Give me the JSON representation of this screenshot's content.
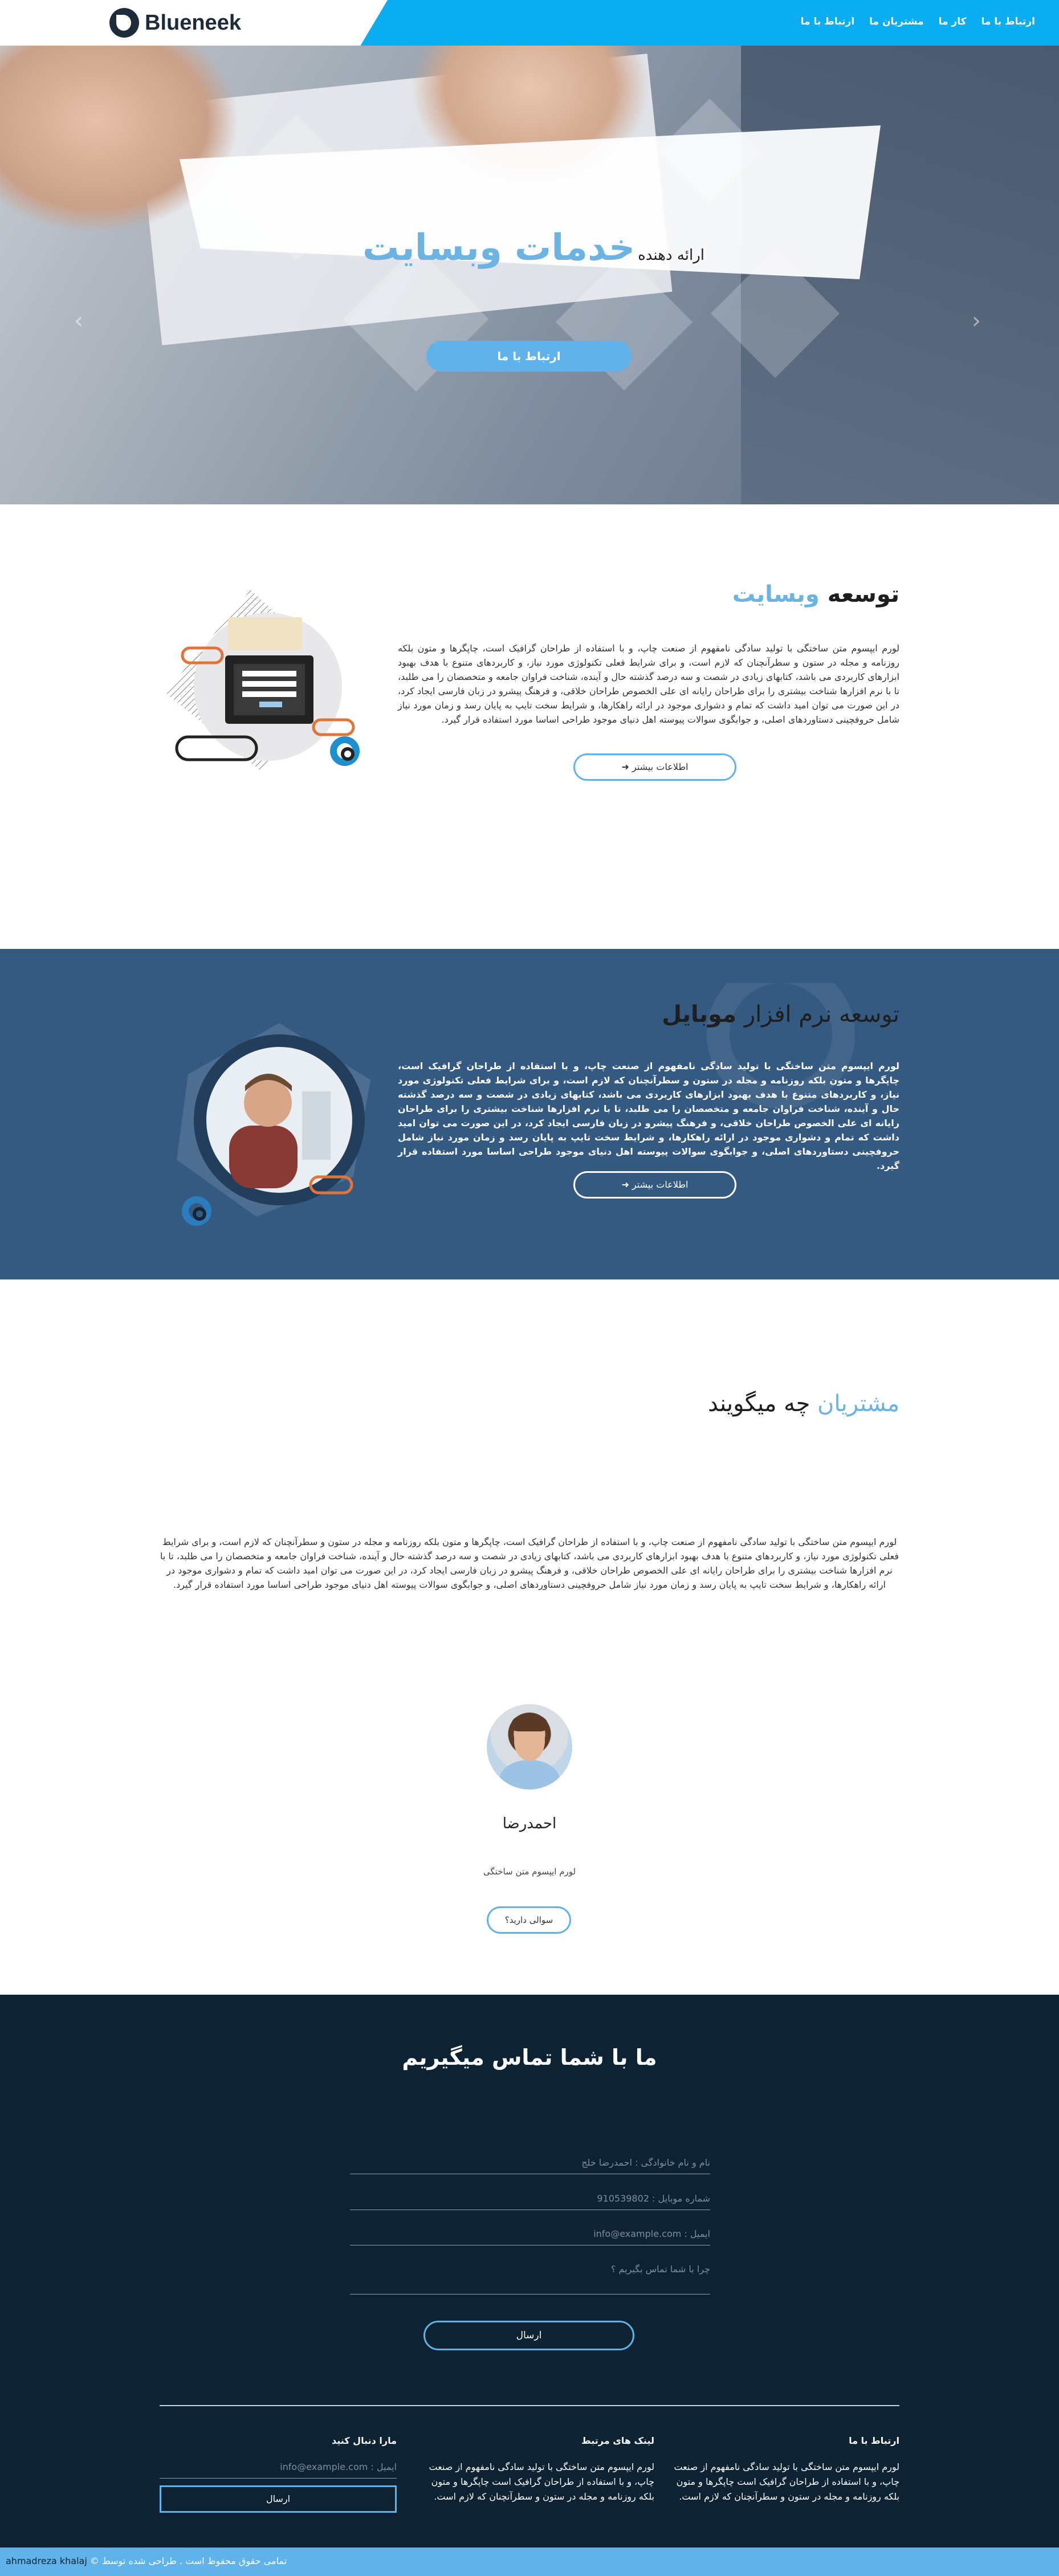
{
  "header": {
    "logo_text": "Blueneek",
    "nav": [
      "ارتباط با ما",
      "کار ما",
      "مشتریان ما",
      "ارتباط با ما"
    ]
  },
  "hero": {
    "subtitle": "ارائه دهنده",
    "title": "خدمات وبسایت",
    "button": "ارتباط با ما"
  },
  "web_section": {
    "title_main": "توسعه",
    "title_highlight": "وبسایت",
    "text": "لورم ایپسوم متن ساختگی با تولید سادگی نامفهوم از صنعت چاپ، و با استفاده از طراحان گرافیک است، چاپگرها و متون بلکه روزنامه و مجله در ستون و سطرآنچنان که لازم است، و برای شرایط فعلی تکنولوژی مورد نیاز، و کاربردهای متنوع با هدف بهبود ابزارهای کاربردی می باشد، کتابهای زیادی در شصت و سه درصد گذشته حال و آینده، شناخت فراوان جامعه و متخصصان را می طلبد، تا با نرم افزارها شناخت بیشتری را برای طراحان رایانه ای علی الخصوص طراحان خلاقی، و فرهنگ پیشرو در زبان فارسی ایجاد کرد، در این صورت می توان امید داشت که تمام و دشواری موجود در ارائه راهکارها، و شرایط سخت تایپ به پایان رسد و زمان مورد نیاز شامل حروفچینی دستاوردهای اصلی، و جوابگوی سوالات پیوسته اهل دنیای موجود طراحی اساسا مورد استفاده قرار گیرد.",
    "button": "اطلاعات بیشتر"
  },
  "mobile_section": {
    "title_light": "توسعه نرم افزار",
    "title_bold": "موبایل",
    "text": "لورم ایپسوم متن ساختگی با تولید سادگی نامفهوم از صنعت چاپ، و با استفاده از طراحان گرافیک است، چاپگرها و متون بلکه روزنامه و مجله در ستون و سطرآنچنان که لازم است، و برای شرایط فعلی تکنولوژی مورد نیاز، و کاربردهای متنوع با هدف بهبود ابزارهای کاربردی می باشد، کتابهای زیادی در شصت و سه درصد گذشته حال و آینده، شناخت فراوان جامعه و متخصصان را می طلبد، تا با نرم افزارها شناخت بیشتری را برای طراحان رایانه ای علی الخصوص طراحان خلاقی، و فرهنگ پیشرو در زبان فارسی ایجاد کرد، در این صورت می توان امید داشت که تمام و دشواری موجود در ارائه راهکارها، و شرایط سخت تایپ به پایان رسد و زمان مورد نیاز شامل حروفچینی دستاوردهای اصلی، و جوابگوی سوالات پیوسته اهل دنیای موجود طراحی اساسا مورد استفاده قرار گیرد.",
    "button": "اطلاعات بیشتر"
  },
  "customers": {
    "title_highlight": "مشتریان",
    "title_rest": "چه میگویند",
    "text": "لورم ایپسوم متن ساختگی با تولید سادگی نامفهوم از صنعت چاپ، و با استفاده از طراحان گرافیک است، چاپگرها و متون بلکه روزنامه و مجله در ستون و سطرآنچنان که لازم است، و برای شرایط فعلی تکنولوژی مورد نیاز، و کاربردهای متنوع با هدف بهبود ابزارهای کاربردی می باشد، کتابهای زیادی در شصت و سه درصد گذشته حال و آینده، شناخت فراوان جامعه و متخصصان را می طلبد، تا با نرم افزارها شناخت بیشتری را برای طراحان رایانه ای علی الخصوص طراحان خلاقی، و فرهنگ پیشرو در زبان فارسی ایجاد کرد، در این صورت می توان امید داشت که تمام و دشواری موجود در ارائه راهکارها، و شرایط سخت تایپ به پایان رسد و زمان مورد نیاز شامل حروفچینی دستاوردهای اصلی، و جوابگوی سوالات پیوسته اهل دنیای موجود طراحی اساسا مورد استفاده قرار گیرد.",
    "person_name": "احمدرضا",
    "person_caption": "لورم ایپسوم متن ساختگی",
    "button": "سوالی دارید؟"
  },
  "contact": {
    "title": "ما با شما تماس میگیریم",
    "name_placeholder": "نام و نام خانوادگی : احمدرضا خلج",
    "phone_placeholder": "شماره موبایل : 910539802",
    "email_placeholder": "ایمیل : info@example.com",
    "message_placeholder": "چرا با شما تماس بگیریم ؟",
    "submit": "ارسال"
  },
  "footer": {
    "col1_title": "ارتباط با ما",
    "col1_text": "لورم ایپسوم متن ساختگی با تولید سادگی نامفهوم از صنعت چاپ، و با استفاده از طراحان گرافیک است چاپگرها و متون بلکه روزنامه و مجله در ستون و سطرآنچنان که لازم است.",
    "col2_title": "لینک های مرتبط",
    "col2_text": "لورم ایپسوم متن ساختگی با تولید سادگی نامفهوم از صنعت چاپ، و با استفاده از طراحان گرافیک است چاپگرها و متون بلکه روزنامه و مجله در ستون و سطرآنچنان که لازم است.",
    "col3_title": "مارا دنبال کنید",
    "email_placeholder": "ایمیل : info@example.com",
    "submit": "ارسال"
  },
  "bottom_bar": {
    "copyright": "© تمامی حقوق محفوظ است . طراحی شده توسط",
    "author": "ahmadreza khalaj"
  },
  "colors": {
    "accent": "#0aaef0",
    "light_blue": "#5fb3ea",
    "mobile_bg": "#355a82",
    "dark_bg": "#0d2233"
  }
}
